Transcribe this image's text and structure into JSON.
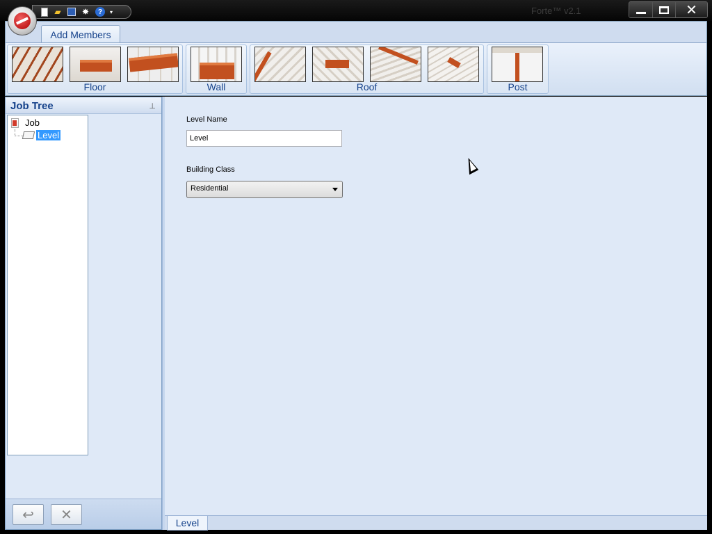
{
  "window": {
    "title": "Forte™ v2.1",
    "min_glyph": "",
    "max_glyph": "",
    "close_glyph": "✕"
  },
  "quick_access": {
    "icons": [
      "new-document-icon",
      "open-folder-icon",
      "save-icon",
      "settings-gear-icon",
      "help-icon",
      "dropdown-arrow-icon"
    ],
    "help_glyph": "?",
    "gear_glyph": "✸",
    "drop_glyph": "▾"
  },
  "ribbon": {
    "tab_label": "Add Members",
    "groups": [
      {
        "label": "Floor",
        "buttons": [
          "floor-joists",
          "floor-beam",
          "floor-flush-beam"
        ]
      },
      {
        "label": "Wall",
        "buttons": [
          "wall-header"
        ]
      },
      {
        "label": "Roof",
        "buttons": [
          "roof-rafters",
          "roof-ridge-beam",
          "roof-hip-valley",
          "roof-dropped-beam"
        ]
      },
      {
        "label": "Post",
        "buttons": [
          "post"
        ]
      }
    ]
  },
  "job_tree": {
    "title": "Job Tree",
    "pin_glyph": "⊥",
    "nodes": [
      {
        "label": "Job"
      },
      {
        "label": "Level",
        "selected": true
      }
    ],
    "footer": {
      "rename_glyph": "↩",
      "delete_glyph": "✕"
    }
  },
  "level_form": {
    "name_label": "Level Name",
    "name_value": "Level",
    "class_label": "Building Class",
    "class_value": "Residential"
  },
  "doc_tabs": [
    {
      "label": "Level"
    }
  ],
  "colors": {
    "ribbon_text": "#15428b",
    "selection": "#3399ff",
    "accent_member": "#c2501f"
  }
}
